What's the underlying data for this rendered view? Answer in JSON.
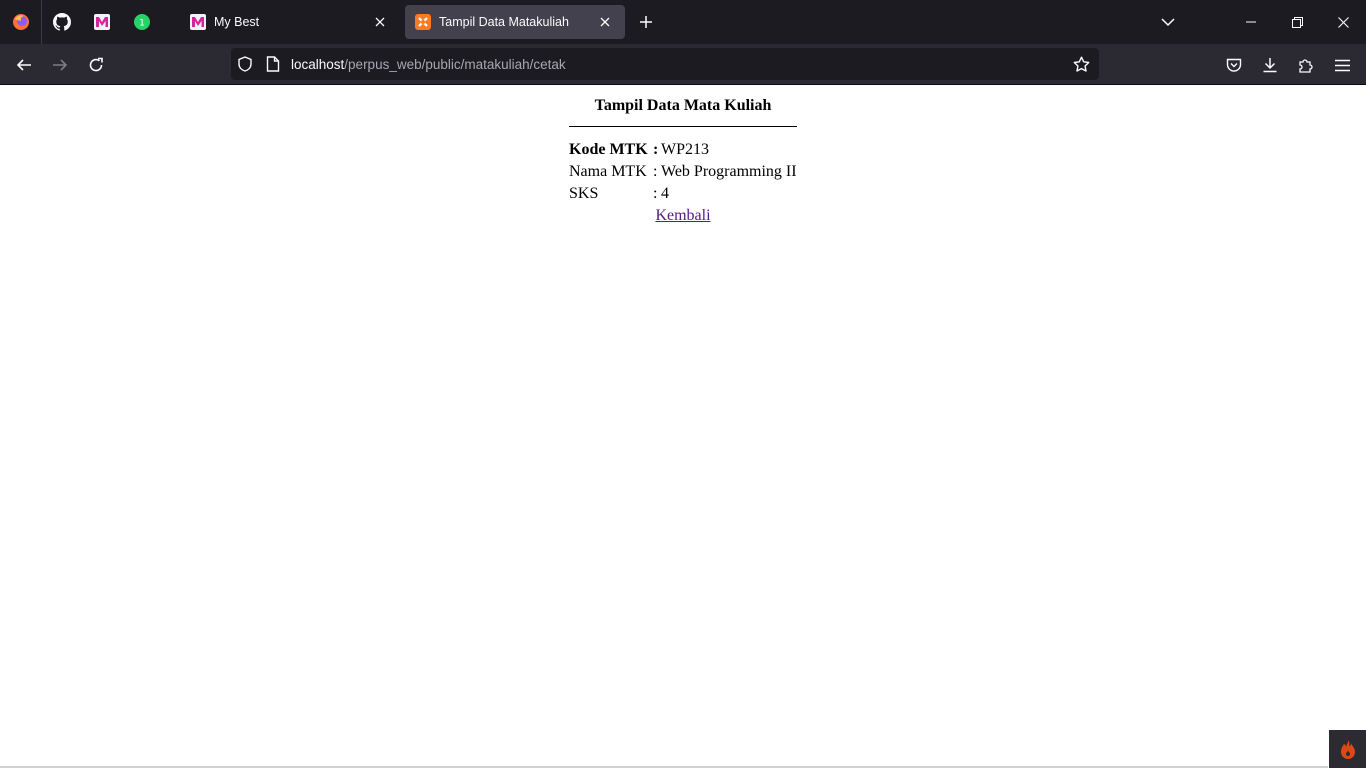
{
  "browser": {
    "tabs": [
      {
        "label": "My Best",
        "icon": "m-badge-icon"
      },
      {
        "label": "Tampil Data Matakuliah",
        "icon": "xampp-icon",
        "active": true
      }
    ],
    "pinned": [
      "github-icon",
      "m-badge-icon",
      "whatsapp-icon"
    ],
    "whatsapp_badge": "1",
    "url": {
      "host": "localhost",
      "path": "/perpus_web/public/matakuliah/cetak"
    }
  },
  "page": {
    "heading": "Tampil Data Mata Kuliah",
    "fields": [
      {
        "label": "Kode MTK",
        "sep": ":",
        "value": "WP213"
      },
      {
        "label": "Nama MTK",
        "sep": ":",
        "value": "Web Programming II"
      },
      {
        "label": "SKS",
        "sep": ":",
        "value": "4"
      }
    ],
    "back_link": "Kembali"
  },
  "colors": {
    "tabstrip_bg": "#1c1b22",
    "navbar_bg": "#2b2a33",
    "active_tab_bg": "#42414d",
    "link_visited": "#551a8b"
  }
}
